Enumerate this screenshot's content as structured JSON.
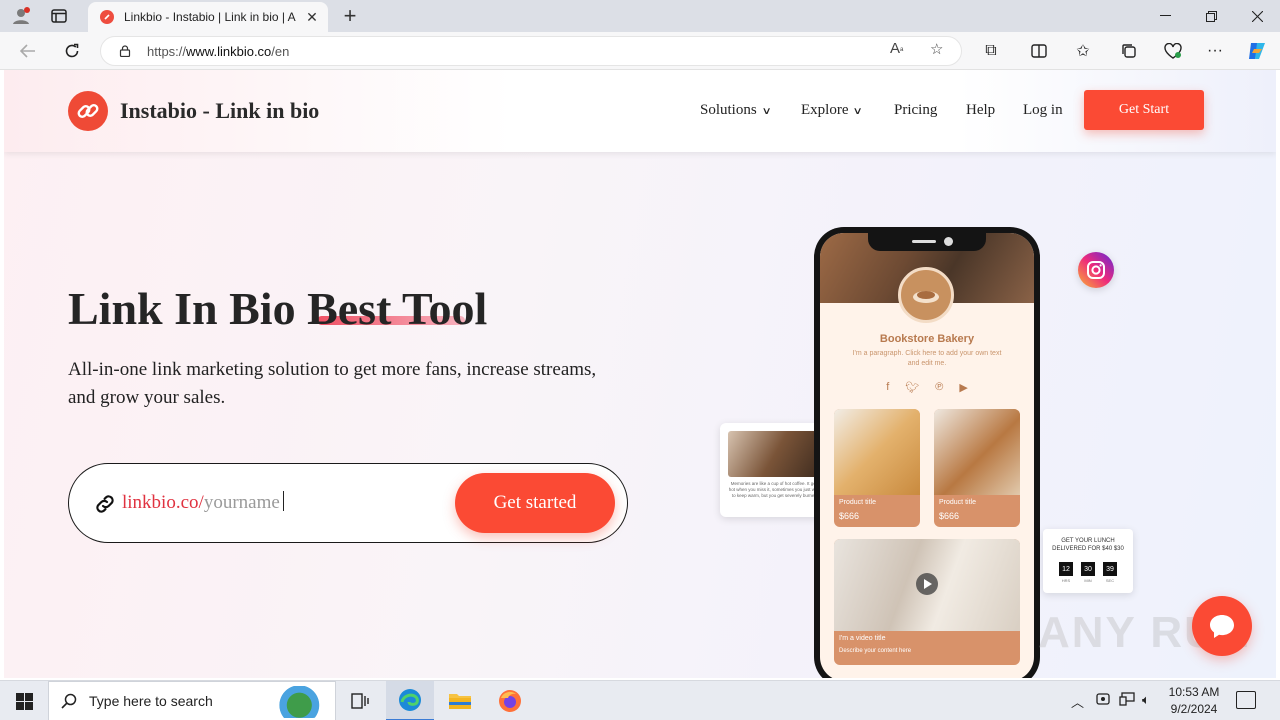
{
  "browser": {
    "tab_title": "Linkbio - Instabio | Link in bio | A",
    "url_prefix": "https://",
    "url_host": "www.linkbio.co",
    "url_path": "/en"
  },
  "header": {
    "logo_text": "Instabio - Link in bio",
    "nav": [
      {
        "label": "Solutions",
        "dropdown": true
      },
      {
        "label": "Explore",
        "dropdown": true
      },
      {
        "label": "Pricing"
      },
      {
        "label": "Help"
      },
      {
        "label": "Log in"
      }
    ],
    "cta_label": "Get Start"
  },
  "hero": {
    "title": "Link In Bio Best Tool",
    "subtitle": "All-in-one link marketing solution to get more fans, increase streams, and grow your sales.",
    "claim_domain": "linkbio.co/",
    "claim_placeholder": "yourname",
    "cta_label": "Get started"
  },
  "phone": {
    "profile_name": "Bookstore Bakery",
    "profile_desc": "I'm a paragraph. Click here to add your own text and edit me.",
    "products": [
      {
        "title": "Product title",
        "price": "$666"
      },
      {
        "title": "Product title",
        "price": "$666"
      }
    ],
    "video_title": "I'm a video title",
    "video_desc": "Describe your content here"
  },
  "coffee_card_text": "Memories are like a cup of hot coffee. It gets hot when you miss it, sometimes you just want to keep warm, but you get severely burned.",
  "timer": {
    "title": "GET YOUR LUNCH DELIVERED FOR $40 $30",
    "hours": "12",
    "minutes": "30",
    "seconds": "39",
    "units": [
      "HRS",
      "MIN",
      "SEC"
    ]
  },
  "watermark": "ANY RUN",
  "taskbar": {
    "search_placeholder": "Type here to search",
    "time": "10:53 AM",
    "date": "9/2/2024"
  },
  "colors": {
    "brand": "#fb4a34",
    "accent_red": "#e03240"
  },
  "icons": [
    "profile-icon",
    "tab-actions-icon",
    "back-icon",
    "refresh-icon",
    "lock-icon",
    "read-aloud-icon",
    "favorite-star-icon",
    "extensions-icon",
    "split-screen-icon",
    "favorites-icon",
    "collections-icon",
    "browser-essentials-icon",
    "more-icon",
    "copilot-icon",
    "link-icon",
    "instagram-icon",
    "chat-icon",
    "windows-start-icon",
    "search-icon"
  ]
}
